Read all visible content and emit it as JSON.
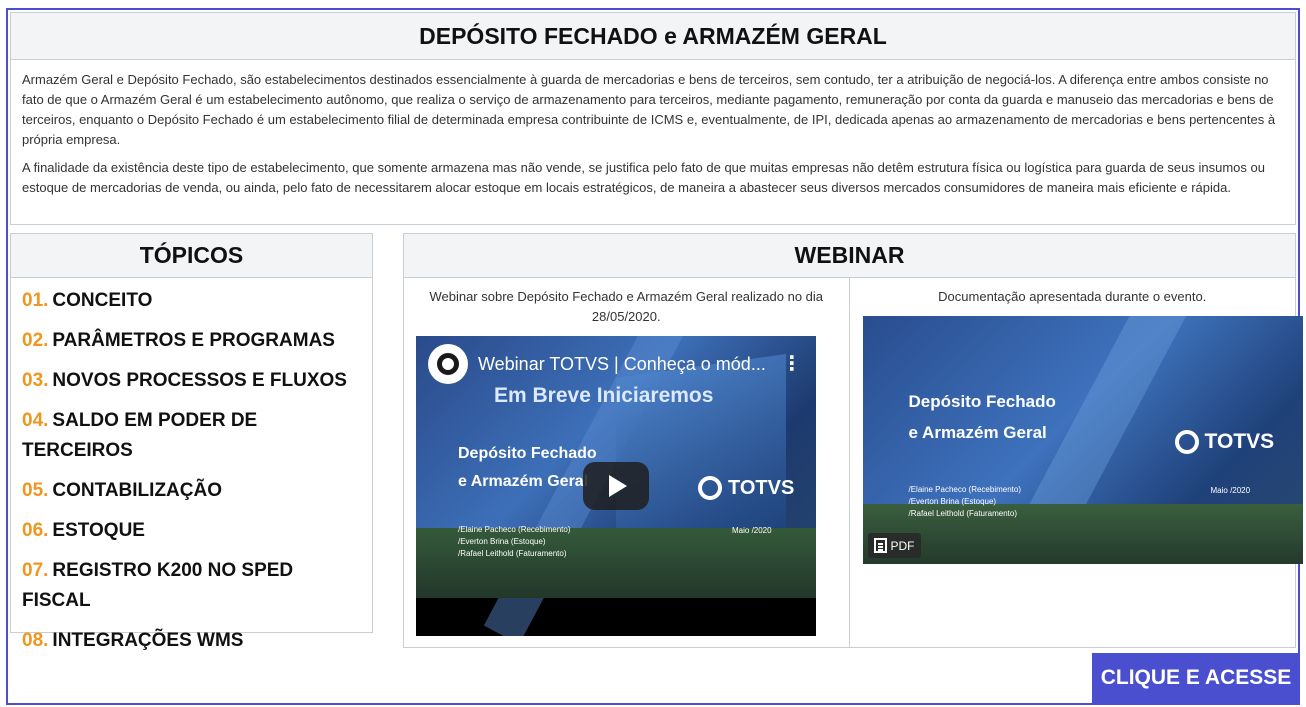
{
  "intro": {
    "title": "DEPÓSITO FECHADO e ARMAZÉM GERAL",
    "paragraphs": [
      "Armazém Geral e Depósito Fechado, são estabelecimentos destinados essencialmente à guarda de mercadorias e bens de terceiros, sem contudo, ter a atribuição de negociá-los. A diferença entre ambos consiste no fato de que o Armazém Geral é um estabelecimento autônomo, que realiza o serviço de armazenamento para terceiros, mediante pagamento, remuneração por conta da guarda e manuseio das mercadorias e bens de terceiros, enquanto o Depósito Fechado é um estabelecimento filial de determinada empresa contribuinte de ICMS e, eventualmente, de IPI, dedicada apenas ao armazenamento de mercadorias e bens pertencentes à própria empresa.",
      "A finalidade da existência deste tipo de estabelecimento, que somente armazena mas não vende, se justifica pelo fato de que muitas empresas não detêm estrutura física ou logística para guarda de seus insumos ou estoque de mercadorias de venda, ou ainda, pelo fato de necessitarem alocar estoque em locais estratégicos, de maneira a abastecer seus diversos mercados consumidores de maneira mais eficiente e rápida."
    ]
  },
  "topics": {
    "title": "TÓPICOS",
    "items": [
      {
        "num": "01.",
        "label": "CONCEITO"
      },
      {
        "num": "02.",
        "label": "PARÂMETROS E PROGRAMAS"
      },
      {
        "num": "03.",
        "label": "NOVOS PROCESSOS E FLUXOS"
      },
      {
        "num": "04.",
        "label": "SALDO EM PODER DE TERCEIROS"
      },
      {
        "num": "05.",
        "label": "CONTABILIZAÇÃO"
      },
      {
        "num": "06.",
        "label": "ESTOQUE"
      },
      {
        "num": "07.",
        "label": "REGISTRO K200 NO SPED FISCAL"
      },
      {
        "num": "08.",
        "label": "INTEGRAÇÕES WMS"
      }
    ]
  },
  "webinar": {
    "title": "WEBINAR",
    "video_caption": "Webinar sobre Depósito Fechado e Armazém Geral realizado no dia 28/05/2020.",
    "doc_caption": "Documentação apresentada durante o evento.",
    "video": {
      "title": "Webinar TOTVS | Conheça o mód...",
      "banner": "Em Breve Iniciaremos",
      "subject_line1": "Depósito Fechado",
      "subject_line2": "e Armazém Geral",
      "brand": "TOTVS",
      "names": [
        "/Elaine Pacheco (Recebimento)",
        "/Everton Brina (Estoque)",
        "/Rafael Leithold (Faturamento)"
      ],
      "date": "Maio /2020"
    },
    "doc": {
      "subject_line1": "Depósito Fechado",
      "subject_line2": "e Armazém Geral",
      "brand": "TOTVS",
      "names": [
        "/Elaine Pacheco (Recebimento)",
        "/Everton Brina (Estoque)",
        "/Rafael Leithold (Faturamento)"
      ],
      "date": "Maio /2020",
      "badge": "PDF"
    }
  },
  "cta": {
    "label": "CLIQUE E ACESSE"
  },
  "colors": {
    "accent": "#4a4fd0",
    "topic_number": "#f0961e"
  }
}
